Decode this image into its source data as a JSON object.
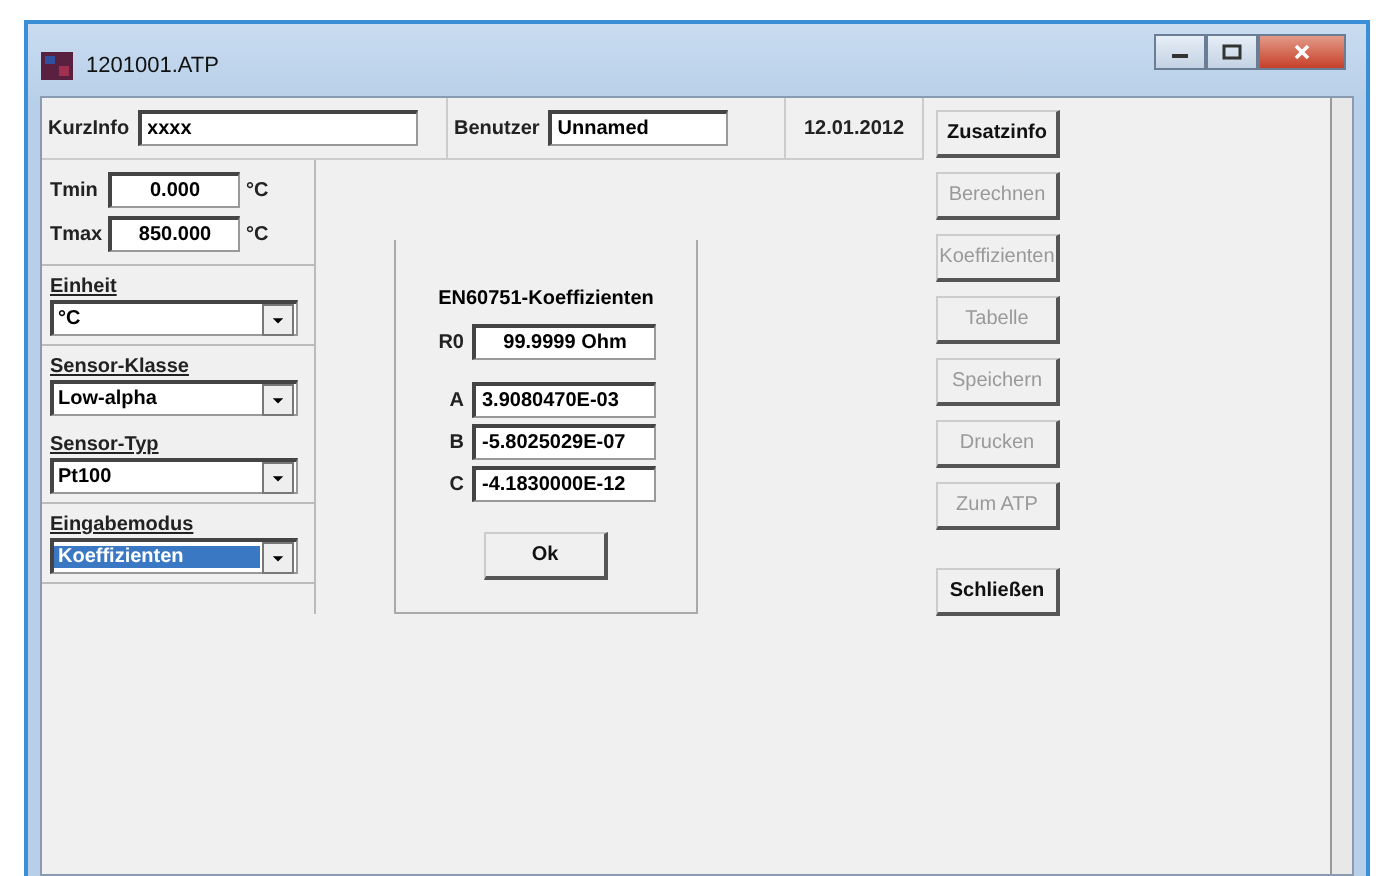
{
  "window": {
    "title": "1201001.ATP"
  },
  "header": {
    "kurzinfo": {
      "label": "KurzInfo",
      "value": "xxxx"
    },
    "benutzer": {
      "label": "Benutzer",
      "value": "Unnamed"
    },
    "date": "12.01.2012"
  },
  "temps": [
    {
      "label": "Tmin",
      "value": "0.000",
      "unit": "°C"
    },
    {
      "label": "Tmax",
      "value": "850.000",
      "unit": "°C"
    }
  ],
  "select_groups": [
    [
      {
        "label": "Einheit",
        "value": "°C",
        "selected": false
      }
    ],
    [
      {
        "label": "Sensor-Klasse",
        "value": "Low-alpha",
        "selected": false
      },
      {
        "label": "Sensor-Typ",
        "value": "Pt100",
        "selected": false
      }
    ],
    [
      {
        "label": "Eingabemodus",
        "value": "Koeffizienten",
        "selected": true
      }
    ]
  ],
  "coefficients": {
    "title": "EN60751-Koeffizienten",
    "r0": {
      "label": "R0",
      "value": "99.9999 Ohm"
    },
    "rows": [
      {
        "label": "A",
        "value": "3.9080470E-03"
      },
      {
        "label": "B",
        "value": "-5.8025029E-07"
      },
      {
        "label": "C",
        "value": "-4.1830000E-12"
      }
    ],
    "ok": "Ok"
  },
  "buttons": [
    {
      "label": "Zusatzinfo",
      "disabled": false
    },
    {
      "label": "Berechnen",
      "disabled": true
    },
    {
      "label": "Koeffizienten",
      "disabled": true
    },
    {
      "label": "Tabelle",
      "disabled": true
    },
    {
      "label": "Speichern",
      "disabled": true
    },
    {
      "label": "Drucken",
      "disabled": true
    },
    {
      "label": "Zum ATP",
      "disabled": true
    }
  ],
  "close_button": {
    "label": "Schließen",
    "disabled": false
  }
}
